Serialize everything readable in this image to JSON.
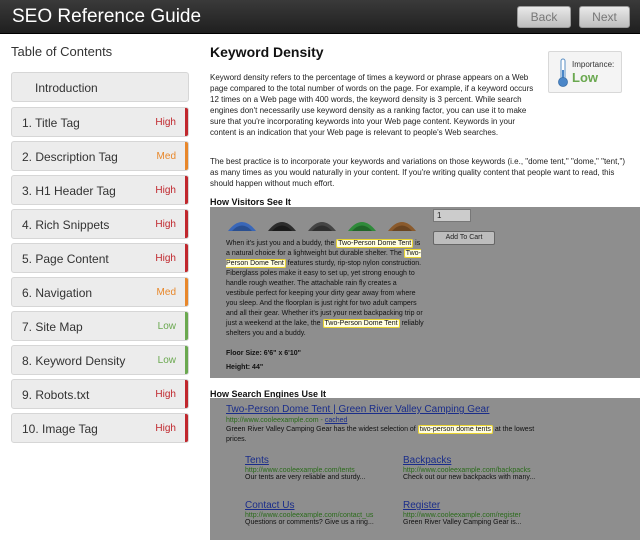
{
  "header": {
    "title": "SEO Reference Guide",
    "back_label": "Back",
    "next_label": "Next"
  },
  "sidebar": {
    "title": "Table of Contents",
    "items": [
      {
        "label": "Introduction",
        "level": ""
      },
      {
        "label": "1. Title Tag",
        "level": "High"
      },
      {
        "label": "2. Description Tag",
        "level": "Med"
      },
      {
        "label": "3. H1 Header Tag",
        "level": "High"
      },
      {
        "label": "4. Rich Snippets",
        "level": "High"
      },
      {
        "label": "5. Page Content",
        "level": "High"
      },
      {
        "label": "6. Navigation",
        "level": "Med"
      },
      {
        "label": "7. Site Map",
        "level": "Low"
      },
      {
        "label": "8. Keyword Density",
        "level": "Low"
      },
      {
        "label": "9. Robots.txt",
        "level": "High"
      },
      {
        "label": "10. Image Tag",
        "level": "High"
      }
    ]
  },
  "colors": {
    "high": "#c0272d",
    "med": "#e8872a",
    "low": "#6aa84f"
  },
  "main": {
    "title": "Keyword Density",
    "paragraph1": "Keyword density refers to the percentage of times a keyword or phrase appears on a Web page compared to the total number of words on the page. For example, if a keyword occurs 12 times on a Web page with 400 words, the keyword density is 3 percent. While search engines don't necessarily use keyword density as a ranking factor, you can use it to make sure that you're incorporating keywords into your Web page content. Keywords in your content is an indication that your Web page is relevant to people's Web searches.",
    "paragraph2": "The best practice is to incorporate your keywords and variations on those keywords (i.e., \"dome tent,\" \"dome,\" \"tent,\") as many times as you would naturally in your content. If you're writing quality content that people want to read, this should happen without much effort.",
    "importance_label": "Importance:",
    "importance_value": "Low"
  },
  "visitors": {
    "title": "How Visitors See It",
    "qty_value": "1",
    "cart_label": "Add To Cart",
    "desc_parts": [
      "When it's just you and a buddy, the ",
      "Two-Person Dome Tent",
      " is a natural choice for a lightweight but durable shelter. The ",
      "Two-Person Dome Tent",
      " features sturdy, rip-stop nylon construction. Fiberglass poles make it easy to set up, yet strong enough to handle rough weather. The attachable rain fly creates a vestibule perfect for keeping your dirty gear away from where you sleep. And the floorplan is just right for two adult campers and all their gear. Whether it's just your next backpacking trip or just a weekend at the lake, the ",
      "Two-Person Dome Tent",
      " reliably shelters you and a buddy."
    ],
    "floor_size": "Floor Size: 6'6\" x 6'10\"",
    "height": "Height: 44\""
  },
  "engines": {
    "title": "How Search Engines Use It",
    "result_title": "Two-Person Dome Tent | Green River Valley Camping Gear",
    "result_url": "http://www.cooleexample.com - ",
    "result_cached": "cached",
    "result_desc_before": "Green River Valley Camping Gear has the widest selection of ",
    "result_desc_hl": "two-person dome tents",
    "result_desc_after": " at the lowest prices.",
    "sublinks": [
      {
        "title": "Tents",
        "url": "http://www.cooleexample.com/tents",
        "desc": "Our tents are very reliable and sturdy..."
      },
      {
        "title": "Backpacks",
        "url": "http://www.cooleexample.com/backpacks",
        "desc": "Check out our new backpacks with many..."
      },
      {
        "title": "Contact Us",
        "url": "http://www.cooleexample.com/contact_us",
        "desc": "Questions or comments? Give us a ring..."
      },
      {
        "title": "Register",
        "url": "http://www.cooleexample.com/register",
        "desc": "Green River Valley Camping Gear is..."
      }
    ]
  }
}
